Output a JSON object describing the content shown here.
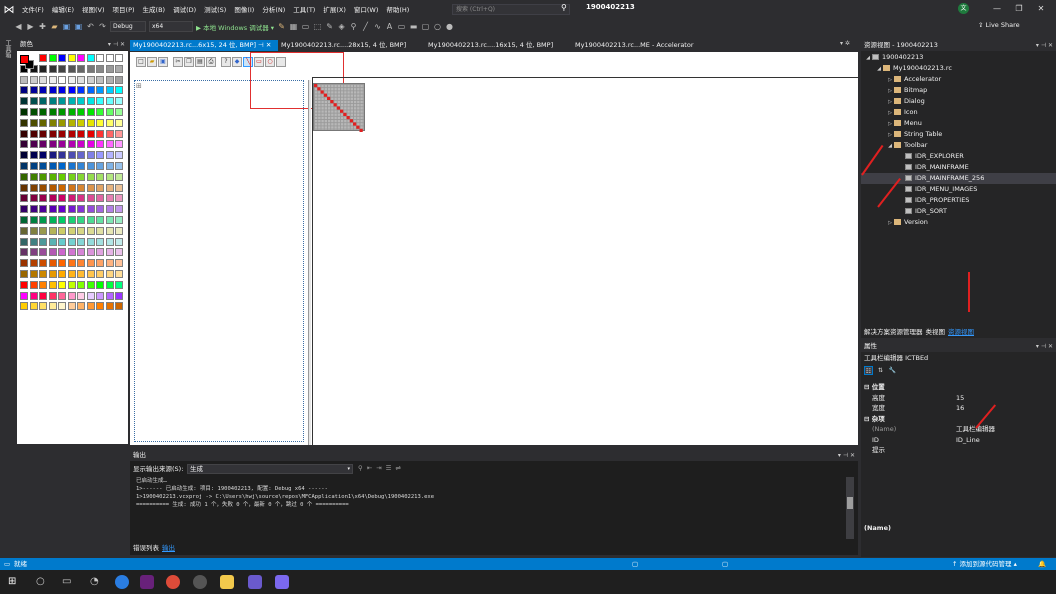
{
  "menubar": {
    "items": [
      "文件(F)",
      "编辑(E)",
      "视图(V)",
      "项目(P)",
      "生成(B)",
      "调试(D)",
      "测试(S)",
      "图像(I)",
      "分析(N)",
      "工具(T)",
      "扩展(X)",
      "窗口(W)",
      "帮助(H)"
    ],
    "search_placeholder": "搜索 (Ctrl+Q)",
    "project_name": "1900402213",
    "avatar_initial": "文"
  },
  "toolbar": {
    "config": "Debug",
    "platform": "x64",
    "run_label": "▶ 本地 Windows 调试器 ▾",
    "live_share": "Live Share"
  },
  "sidestrip": {
    "labels": [
      "工具箱"
    ]
  },
  "colors_panel": {
    "title": "颜色",
    "foreground": "#ff0000",
    "background": "#000000"
  },
  "doc_tabs": [
    {
      "label": "My1900402213.rc...6x15, 24 位, BMP]",
      "active": true
    },
    {
      "label": "My1900402213.rc....28x15, 4 位, BMP]",
      "active": false
    },
    {
      "label": "My1900402213.rc....16x15, 4 位, BMP]",
      "active": false
    },
    {
      "label": "My1900402213.rc...ME - Accelerator",
      "active": false
    }
  ],
  "resource_view": {
    "title": "资源视图 - 1900402213",
    "tree": [
      {
        "label": "1900402213",
        "level": 0,
        "icon": "rc",
        "arrow": "◢"
      },
      {
        "label": "My1900402213.rc",
        "level": 1,
        "icon": "folder",
        "arrow": "◢"
      },
      {
        "label": "Accelerator",
        "level": 2,
        "icon": "folder",
        "arrow": "▷"
      },
      {
        "label": "Bitmap",
        "level": 2,
        "icon": "folder",
        "arrow": "▷"
      },
      {
        "label": "Dialog",
        "level": 2,
        "icon": "folder",
        "arrow": "▷"
      },
      {
        "label": "Icon",
        "level": 2,
        "icon": "folder",
        "arrow": "▷"
      },
      {
        "label": "Menu",
        "level": 2,
        "icon": "folder",
        "arrow": "▷"
      },
      {
        "label": "String Table",
        "level": 2,
        "icon": "folder",
        "arrow": "▷"
      },
      {
        "label": "Toolbar",
        "level": 2,
        "icon": "folder",
        "arrow": "◢"
      },
      {
        "label": "IDR_EXPLORER",
        "level": 3,
        "icon": "rc",
        "arrow": ""
      },
      {
        "label": "IDR_MAINFRAME",
        "level": 3,
        "icon": "rc",
        "arrow": ""
      },
      {
        "label": "IDR_MAINFRAME_256",
        "level": 3,
        "icon": "rc",
        "arrow": "",
        "selected": true
      },
      {
        "label": "IDR_MENU_IMAGES",
        "level": 3,
        "icon": "rc",
        "arrow": ""
      },
      {
        "label": "IDR_PROPERTIES",
        "level": 3,
        "icon": "rc",
        "arrow": ""
      },
      {
        "label": "IDR_SORT",
        "level": 3,
        "icon": "rc",
        "arrow": ""
      },
      {
        "label": "Version",
        "level": 2,
        "icon": "folder",
        "arrow": "▷"
      }
    ],
    "tabs": [
      "解决方案资源管理器",
      "类视图",
      "资源视图"
    ]
  },
  "properties": {
    "title": "属性",
    "subject": "工具栏编辑器  ICTBEd",
    "rows": [
      {
        "key": "位置",
        "value": "",
        "cat": true
      },
      {
        "key": "高度",
        "value": "15"
      },
      {
        "key": "宽度",
        "value": "16"
      },
      {
        "key": "杂项",
        "value": "",
        "cat": true
      },
      {
        "key": "(Name)",
        "value": "工具栏编辑器",
        "dim": true
      },
      {
        "key": "ID",
        "value": "ID_Line"
      },
      {
        "key": "提示",
        "value": ""
      }
    ],
    "description": "(Name)"
  },
  "output": {
    "title": "输出",
    "source_label": "显示输出来源(S):",
    "source_value": "生成",
    "lines": [
      "已启动生成…",
      "1>------ 已启动生成: 项目: 1900402213, 配置: Debug x64 ------",
      "1>1900402213.vcxproj -> C:\\Users\\hwj\\source\\repos\\MFCApplication1\\x64\\Debug\\1900402213.exe",
      "========== 生成: 成功 1 个，失败 0 个，最新 0 个，跳过 0 个 =========="
    ],
    "tabs": [
      "错误列表",
      "输出"
    ]
  },
  "statusbar": {
    "left": "就绪",
    "right": "↑ 添加到源代码管理 ▴"
  }
}
